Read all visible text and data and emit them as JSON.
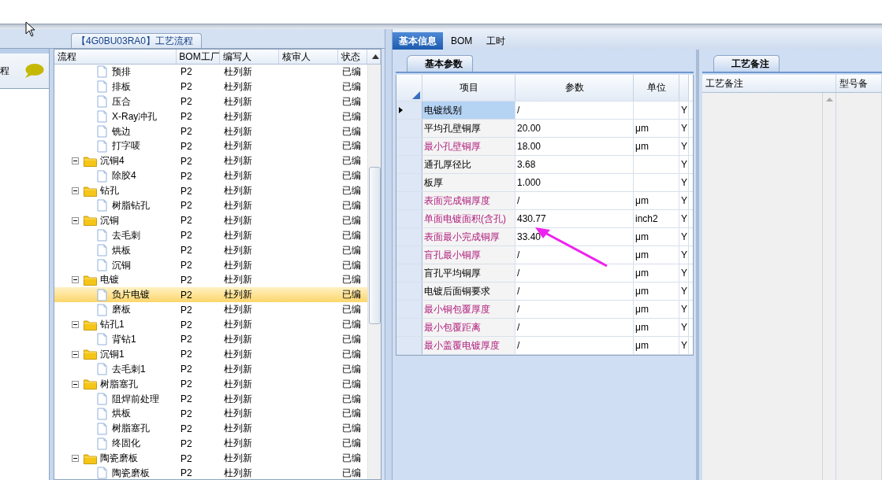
{
  "left_strip": {
    "label": "程"
  },
  "process_group": {
    "title": "【4G0BU03RA0】工艺流程"
  },
  "tree": {
    "columns": [
      "流程",
      "BOM工厂",
      "编写人",
      "核审人",
      "状态"
    ],
    "continued_children": [
      {
        "name": "预排",
        "bom": "P2",
        "writer": "杜列新",
        "status": "已编",
        "selected": false
      },
      {
        "name": "排板",
        "bom": "P2",
        "writer": "杜列新",
        "status": "已编",
        "selected": false
      },
      {
        "name": "压合",
        "bom": "P2",
        "writer": "杜列新",
        "status": "已编",
        "selected": false
      },
      {
        "name": "X-Ray冲孔",
        "bom": "P2",
        "writer": "杜列新",
        "status": "已编",
        "selected": false
      },
      {
        "name": "铣边",
        "bom": "P2",
        "writer": "杜列新",
        "status": "已编",
        "selected": false
      },
      {
        "name": "打字唛",
        "bom": "P2",
        "writer": "杜列新",
        "status": "已编",
        "selected": false
      }
    ],
    "nodes": [
      {
        "name": "沉铜4",
        "bom": "P2",
        "writer": "杜列新",
        "status": "已编",
        "expanded": true,
        "children": [
          {
            "name": "除胶4",
            "bom": "P2",
            "writer": "杜列新",
            "status": "已编",
            "selected": false
          }
        ]
      },
      {
        "name": "钻孔",
        "bom": "P2",
        "writer": "杜列新",
        "status": "已编",
        "expanded": true,
        "children": [
          {
            "name": "树脂钻孔",
            "bom": "P2",
            "writer": "杜列新",
            "status": "已编",
            "selected": false
          }
        ]
      },
      {
        "name": "沉铜",
        "bom": "P2",
        "writer": "杜列新",
        "status": "已编",
        "expanded": true,
        "children": [
          {
            "name": "去毛刺",
            "bom": "P2",
            "writer": "杜列新",
            "status": "已编",
            "selected": false
          },
          {
            "name": "烘板",
            "bom": "P2",
            "writer": "杜列新",
            "status": "已编",
            "selected": false
          },
          {
            "name": "沉铜",
            "bom": "P2",
            "writer": "杜列新",
            "status": "已编",
            "selected": false
          }
        ]
      },
      {
        "name": "电镀",
        "bom": "P2",
        "writer": "杜列新",
        "status": "已编",
        "expanded": true,
        "children": [
          {
            "name": "负片电镀",
            "bom": "P2",
            "writer": "杜列新",
            "status": "已编",
            "selected": true
          },
          {
            "name": "磨板",
            "bom": "P2",
            "writer": "杜列新",
            "status": "已编",
            "selected": false
          }
        ]
      },
      {
        "name": "钻孔1",
        "bom": "P2",
        "writer": "杜列新",
        "status": "已编",
        "expanded": true,
        "children": [
          {
            "name": "背钻1",
            "bom": "P2",
            "writer": "杜列新",
            "status": "已编",
            "selected": false
          }
        ]
      },
      {
        "name": "沉铜1",
        "bom": "P2",
        "writer": "杜列新",
        "status": "已编",
        "expanded": true,
        "children": [
          {
            "name": "去毛刺1",
            "bom": "P2",
            "writer": "杜列新",
            "status": "已编",
            "selected": false
          }
        ]
      },
      {
        "name": "树脂塞孔",
        "bom": "P2",
        "writer": "杜列新",
        "status": "已编",
        "expanded": true,
        "children": [
          {
            "name": "阻焊前处理",
            "bom": "P2",
            "writer": "杜列新",
            "status": "已编",
            "selected": false
          },
          {
            "name": "烘板",
            "bom": "P2",
            "writer": "杜列新",
            "status": "已编",
            "selected": false
          },
          {
            "name": "树脂塞孔",
            "bom": "P2",
            "writer": "杜列新",
            "status": "已编",
            "selected": false
          },
          {
            "name": "终固化",
            "bom": "P2",
            "writer": "杜列新",
            "status": "已编",
            "selected": false
          }
        ]
      },
      {
        "name": "陶瓷磨板",
        "bom": "P2",
        "writer": "杜列新",
        "status": "已编",
        "expanded": true,
        "children": [
          {
            "name": "陶瓷磨板",
            "bom": "P2",
            "writer": "杜列新",
            "status": "已编",
            "selected": false
          }
        ]
      }
    ]
  },
  "tabs": [
    {
      "label": "基本信息",
      "selected": true
    },
    {
      "label": "BOM",
      "selected": false
    },
    {
      "label": "工时",
      "selected": false
    }
  ],
  "params": {
    "tab": "基本参数",
    "columns": [
      "项目",
      "参数",
      "单位"
    ],
    "rows": [
      {
        "item": "电镀线别",
        "value": "/",
        "flag": "Y",
        "emphasis": false,
        "selected": true
      },
      {
        "item": "平均孔壁铜厚",
        "value": "20.00",
        "unit": "μm",
        "flag": "Y",
        "emphasis": false,
        "selected": false
      },
      {
        "item": "最小孔壁铜厚",
        "value": "18.00",
        "unit": "μm",
        "flag": "Y",
        "emphasis": true,
        "selected": false
      },
      {
        "item": "通孔厚径比",
        "value": "3.68",
        "flag": "Y",
        "emphasis": false,
        "selected": false
      },
      {
        "item": "板厚",
        "value": "1.000",
        "flag": "Y",
        "emphasis": false,
        "selected": false
      },
      {
        "item": "表面完成铜厚度",
        "value": "/",
        "unit": "μm",
        "flag": "Y",
        "emphasis": true,
        "selected": false
      },
      {
        "item": "单面电镀面积(含孔)",
        "value": "430.77",
        "unit": "inch2",
        "flag": "Y",
        "emphasis": true,
        "selected": false
      },
      {
        "item": "表面最小完成铜厚",
        "value": "33.40",
        "unit": "μm",
        "flag": "Y",
        "emphasis": true,
        "selected": false
      },
      {
        "item": "盲孔最小铜厚",
        "value": "/",
        "unit": "μm",
        "flag": "Y",
        "emphasis": true,
        "selected": false
      },
      {
        "item": "盲孔平均铜厚",
        "value": "/",
        "unit": "μm",
        "flag": "Y",
        "emphasis": false,
        "selected": false
      },
      {
        "item": "电镀后面铜要求",
        "value": "/",
        "unit": "μm",
        "flag": "Y",
        "emphasis": false,
        "selected": false
      },
      {
        "item": "最小铜包覆厚度",
        "value": "/",
        "unit": "μm",
        "flag": "Y",
        "emphasis": true,
        "selected": false
      },
      {
        "item": "最小包覆距离",
        "value": "/",
        "unit": "μm",
        "flag": "Y",
        "emphasis": true,
        "selected": false
      },
      {
        "item": "最小盖覆电镀厚度",
        "value": "/",
        "unit": "μm",
        "flag": "Y",
        "emphasis": true,
        "selected": false
      }
    ]
  },
  "notes": {
    "tab": "工艺备注",
    "columns": [
      "工艺备注",
      "型号备"
    ]
  }
}
